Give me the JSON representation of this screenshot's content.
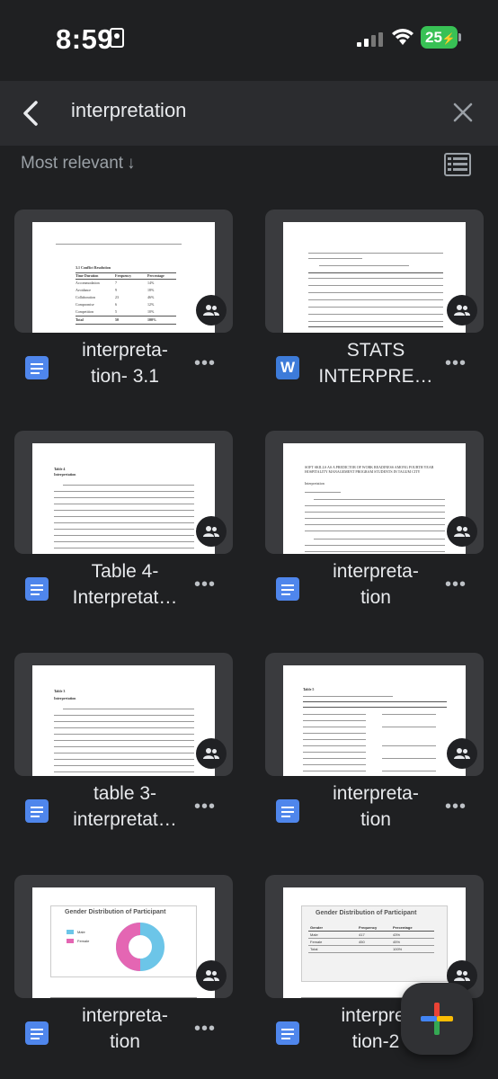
{
  "status_bar": {
    "time": "8:59",
    "battery": "25",
    "battery_color": "#38c155"
  },
  "search": {
    "query": "interpretation",
    "back_icon": "chevron-left-icon",
    "clear_icon": "close-icon"
  },
  "sort": {
    "label": "Most relevant",
    "arrow": "↓",
    "view_icon": "list-view-icon"
  },
  "files": [
    {
      "title": "interpreta-\ntion- 3.1",
      "type": "doc",
      "shared": true
    },
    {
      "title": "STATS\nINTERPRE…",
      "type": "word",
      "shared": true
    },
    {
      "title": "Table 4-\nInterpretat…",
      "type": "doc",
      "shared": true
    },
    {
      "title": "interpreta-\ntion",
      "type": "doc",
      "shared": true
    },
    {
      "title": "table 3-\ninterpretat…",
      "type": "doc",
      "shared": true
    },
    {
      "title": "interpreta-\ntion",
      "type": "doc",
      "shared": true
    },
    {
      "title": "interpreta-\ntion",
      "type": "doc",
      "shared": true
    },
    {
      "title": "interpret\ntion-2",
      "type": "doc",
      "shared": true
    }
  ],
  "thumbnails": {
    "t1": {
      "heading": "3.1   Conflict Resolution",
      "col1": "Time Duration",
      "col2": "Frequency",
      "col3": "Percentage",
      "rows": [
        [
          "Accommodation",
          "7",
          "14%"
        ],
        [
          "Avoidance",
          "9",
          "18%"
        ],
        [
          "Collaboration",
          "23",
          "46%"
        ],
        [
          "Compromise",
          "6",
          "12%"
        ],
        [
          "Competition",
          "5",
          "10%"
        ],
        [
          "Total",
          "50",
          "100%"
        ]
      ]
    },
    "t3": {
      "heading": "Table 4",
      "sub": "Interpretation"
    },
    "t4": {
      "heading": "SOFT SKILLS AS A PREDICTOR OF WORK READINESS AMONG FOURTH YEAR HOSPITALITY MANAGEMENT PROGRAM STUDENTS IN TAGUM CITY",
      "sub": "Interpretation"
    },
    "t5": {
      "heading": "Table 3",
      "sub": "Interpretation"
    },
    "t6": {
      "heading": "Table 5"
    },
    "t7": {
      "heading": "Gender Distribution of Participant",
      "legend": [
        "Male",
        "Female"
      ]
    },
    "t8": {
      "heading": "Gender Distribution of Participant",
      "col1": "Gender",
      "col2": "Frequency",
      "col3": "Percentage",
      "rows": [
        [
          "Male",
          "417",
          "43%"
        ],
        [
          "Female",
          "450",
          "45%"
        ],
        [
          "Total",
          "",
          "100%"
        ]
      ]
    }
  },
  "fab": {
    "icon": "plus-icon"
  }
}
